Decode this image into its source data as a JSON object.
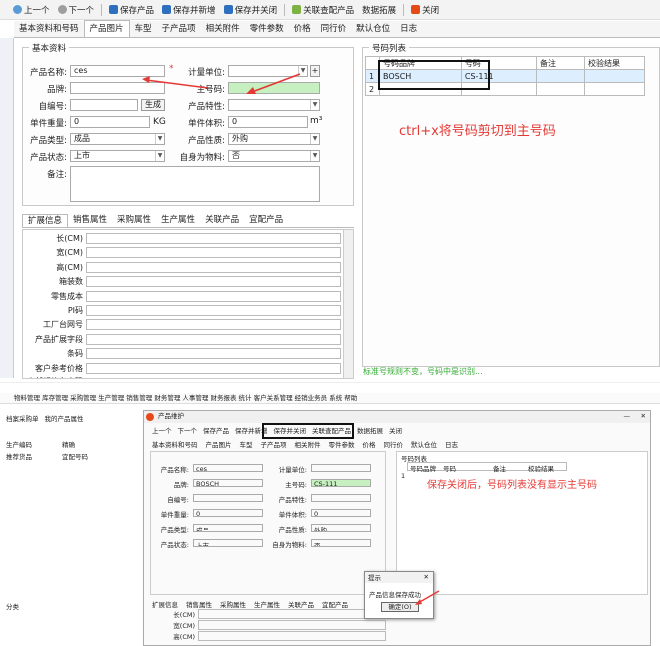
{
  "top": {
    "toolbar": [
      {
        "label": "上一个",
        "icon": "arrow-left-icon",
        "color": "#5b9bd5"
      },
      {
        "label": "下一个",
        "icon": "arrow-right-icon",
        "color": "#9e9e9e"
      },
      {
        "label": "保存产品",
        "icon": "save-icon",
        "color": "#2f6fbf"
      },
      {
        "label": "保存并新增",
        "icon": "save-new-icon",
        "color": "#2f6fbf"
      },
      {
        "label": "保存并关闭",
        "icon": "save-close-icon",
        "color": "#2f6fbf"
      },
      {
        "label": "关联查配产品",
        "icon": "link-icon",
        "color": "#7cb342"
      },
      {
        "label": "数据拓展",
        "icon": "",
        "color": ""
      },
      {
        "label": "关闭",
        "icon": "close-icon",
        "color": "#e64a19"
      }
    ],
    "tabs": [
      "基本资料和号码",
      "产品图片",
      "车型",
      "子产品项",
      "相关附件",
      "零件参数",
      "价格",
      "同行价",
      "默认仓位",
      "日志"
    ],
    "active_tab": 1,
    "basic_legend": "基本资料",
    "fields": {
      "name_label": "产品名称:",
      "name_value": "ces",
      "unit_label": "计量单位:",
      "brand_label": "品牌:",
      "brand_value": "",
      "main_no_label": "主号码:",
      "main_no_value": "",
      "self_no_label": "自编号:",
      "generate_btn": "生成",
      "feature_label": "产品特性:",
      "weight_label": "单件重量:",
      "weight_value": "0",
      "weight_unit": "KG",
      "volume_label": "单件体积:",
      "volume_value": "0",
      "volume_unit": "m³",
      "type_label": "产品类型:",
      "type_value": "成品",
      "nature_label": "产品性质:",
      "nature_value": "外购",
      "status_label": "产品状态:",
      "status_value": "上市",
      "material_label": "自身为物料:",
      "material_value": "否",
      "remark_label": "备注:",
      "plus": "+"
    },
    "number_list": {
      "legend": "号码列表",
      "headers": [
        "号码品牌",
        "号码",
        "备注",
        "校验结果"
      ],
      "rows": [
        {
          "brand": "BOSCH",
          "number": "CS-111",
          "note": "",
          "check": ""
        }
      ],
      "row_nums": [
        "1",
        "2"
      ]
    },
    "annotation": "ctrl+x将号码剪切到主号码",
    "ext_tabs": [
      "扩展信息",
      "销售属性",
      "采购属性",
      "生产属性",
      "关联产品",
      "宜配产品"
    ],
    "ext_fields": [
      "长(CM)",
      "宽(CM)",
      "高(CM)",
      "箱装数",
      "零售成本",
      "PI码",
      "工厂台网号",
      "产品扩展字段",
      "条码",
      "客户参考价格"
    ],
    "ext_partial": "内部规格名字码",
    "bottom_partial": "标准号规则不变，号码中是识别..."
  },
  "bottom": {
    "menubar": "物料管理  库存管理  采购管理  生产管理  销售管理  财务管理  人事管理  财务报表  统计  客户关系管理  经销业务员  系统  帮助",
    "left_tabs": [
      "档案采购单",
      "我的产品属性"
    ],
    "left_checks": [
      "生产编码",
      "推荐货品"
    ],
    "left_checks2": [
      "精确",
      "宜配号码"
    ],
    "left_partial": "分类",
    "window_title": "产品维护",
    "toolbar": [
      "上一个",
      "下一个",
      "保存产品",
      "保存并新增",
      "保存并关闭",
      "关联查配产品",
      "数据拓展",
      "关闭"
    ],
    "tabs": [
      "基本资料和号码",
      "产品图片",
      "车型",
      "子产品项",
      "相关附件",
      "零件参数",
      "价格",
      "同行价",
      "默认仓位",
      "日志"
    ],
    "fields": {
      "name": "ces",
      "brand": "BOSCH",
      "main_no": "CS-111",
      "weight": "0",
      "volume": "0",
      "type": "成品",
      "nature": "外购",
      "status": "上市",
      "material": "否"
    },
    "number_list_legend": "号码列表",
    "annotation": "保存关闭后，号码列表没有显示主号码",
    "ext_tabs": [
      "扩展信息",
      "销售属性",
      "采购属性",
      "生产属性",
      "关联产品",
      "宜配产品"
    ],
    "ext_fields": [
      "长(CM)",
      "宽(CM)",
      "高(CM)"
    ],
    "dialog": {
      "title": "提示",
      "message": "产品信息保存成功",
      "ok": "确定(O)",
      "close": "✕"
    }
  },
  "colors": {
    "highlight_green": "#c6f0c0",
    "accent_red": "#e53935",
    "box_border": "#111111"
  }
}
